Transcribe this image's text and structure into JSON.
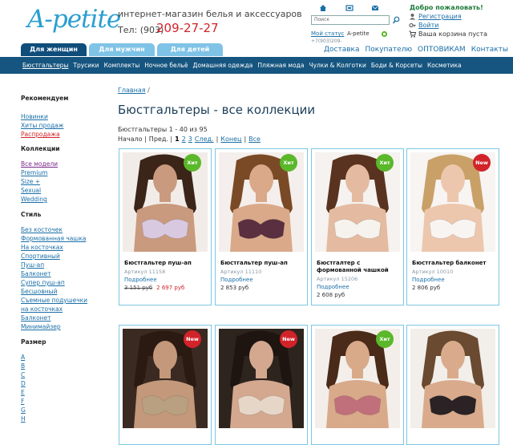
{
  "header": {
    "logo": "A-petite",
    "tagline": "интернет-магазин белья и аксессуаров",
    "phone_label": "Тел: (903)",
    "phone_number": "209-27-27",
    "search_placeholder": "Поиск",
    "my_status_label": "Мой статус",
    "my_status_value": "A-petite",
    "cut_text": "+7(903)209-",
    "welcome": "Добро пожаловать!",
    "register": "Регистрация",
    "login": "Войти",
    "cart": "Ваша корзина пуста"
  },
  "tabs": [
    "Для женщин",
    "Для мужчин",
    "Для детей"
  ],
  "top_links": [
    "Доставка",
    "Покупателю",
    "ОПТОВИКАМ",
    "Контакты"
  ],
  "categories": [
    "Бюстгальтеры",
    "Трусики",
    "Комплекты",
    "Ночное бельё",
    "Домашняя одежда",
    "Пляжная мода",
    "Чулки & Колготки",
    "Боди & Корсеты",
    "Косметика"
  ],
  "sidebar": {
    "recommend_heading": "Рекомендуем",
    "recommend": [
      "Новинки",
      "Хиты продаж",
      "Распродажа"
    ],
    "collections_heading": "Коллекции",
    "collections": [
      "Все модели",
      "Premium",
      "Size +",
      "Sexual",
      "Wedding"
    ],
    "style_heading": "Стиль",
    "style": [
      "Без косточек",
      "Формованная чашка",
      "На косточках",
      "Спортивный",
      "Пуш-ап",
      "Балконет",
      "Супер пуш-ап",
      "Бесшовный",
      "Съемные подушечки",
      "на косточках",
      "Балконет",
      "Минимайзер"
    ],
    "size_heading": "Размер",
    "sizes": [
      "A",
      "B",
      "C",
      "D",
      "E",
      "F",
      "G",
      "H"
    ]
  },
  "main": {
    "breadcrumb_home": "Главная",
    "breadcrumb_sep": "/",
    "title": "Бюстгальтеры - все коллекции",
    "count": "Бюстгальтеры 1 - 40 из 95",
    "pager": {
      "start": "Начало |",
      "prev": "Пред. |",
      "current": "1",
      "p2": "2",
      "p3": "3",
      "next": "След.",
      "sep1": "|",
      "end": "Конец",
      "sep2": "|",
      "all": "Все"
    }
  },
  "products": [
    {
      "name": "Бюстгальтер пуш-ап",
      "sku": "Артикул 11158",
      "more": "Подробнее",
      "old_price": "3 151 руб",
      "price": "2 697 руб",
      "badge": "Хит",
      "badge_color": "#5ab82a",
      "skin": "#c99a7e",
      "hair": "#3b2418",
      "bra": "#d8c8e0",
      "bg": "#f2ece8"
    },
    {
      "name": "Бюстгальтер пуш-ап",
      "sku": "Артикул 11110",
      "more": "Подробнее",
      "old_price": "",
      "price": "2 853 руб",
      "badge": "Хит",
      "badge_color": "#5ab82a",
      "skin": "#d9a98a",
      "hair": "#7a4a26",
      "bra": "#5a3040",
      "bg": "#f4efec"
    },
    {
      "name": "Бюстгалтер с формованной чашкой",
      "sku": "Артикул 15206",
      "more": "Подробнее",
      "old_price": "",
      "price": "2 608 руб",
      "badge": "Хит",
      "badge_color": "#5ab82a",
      "skin": "#e4bba0",
      "hair": "#5a3320",
      "bra": "#f6f3ee",
      "bg": "#f5f2ef"
    },
    {
      "name": "Бюстгальтер балконет",
      "sku": "Артикул 10010",
      "more": "Подробнее",
      "old_price": "",
      "price": "2 806 руб",
      "badge": "New",
      "badge_color": "#d2232a",
      "skin": "#edc7ad",
      "hair": "#c9a067",
      "bra": "#f8f4f2",
      "bg": "#f7f4f2"
    },
    {
      "name": "",
      "sku": "",
      "more": "",
      "old_price": "",
      "price": "",
      "badge": "New",
      "badge_color": "#d2232a",
      "skin": "#c4987a",
      "hair": "#2b1a12",
      "bra": "#b8a080",
      "bg": "#3a2a22"
    },
    {
      "name": "",
      "sku": "",
      "more": "",
      "old_price": "",
      "price": "",
      "badge": "New",
      "badge_color": "#d2232a",
      "skin": "#d3a88e",
      "hair": "#1e1410",
      "bra": "#e6d6c8",
      "bg": "#2e241e"
    },
    {
      "name": "",
      "sku": "",
      "more": "",
      "old_price": "",
      "price": "",
      "badge": "Хит",
      "badge_color": "#5ab82a",
      "skin": "#d8aa8a",
      "hair": "#4a2a18",
      "bra": "#c0707a",
      "bg": "#f3eeea"
    },
    {
      "name": "",
      "sku": "",
      "more": "",
      "old_price": "",
      "price": "",
      "badge": "",
      "badge_color": "",
      "skin": "#d9ab8c",
      "hair": "#6a4a30",
      "bra": "#2a2224",
      "bg": "#f2eeea"
    }
  ]
}
